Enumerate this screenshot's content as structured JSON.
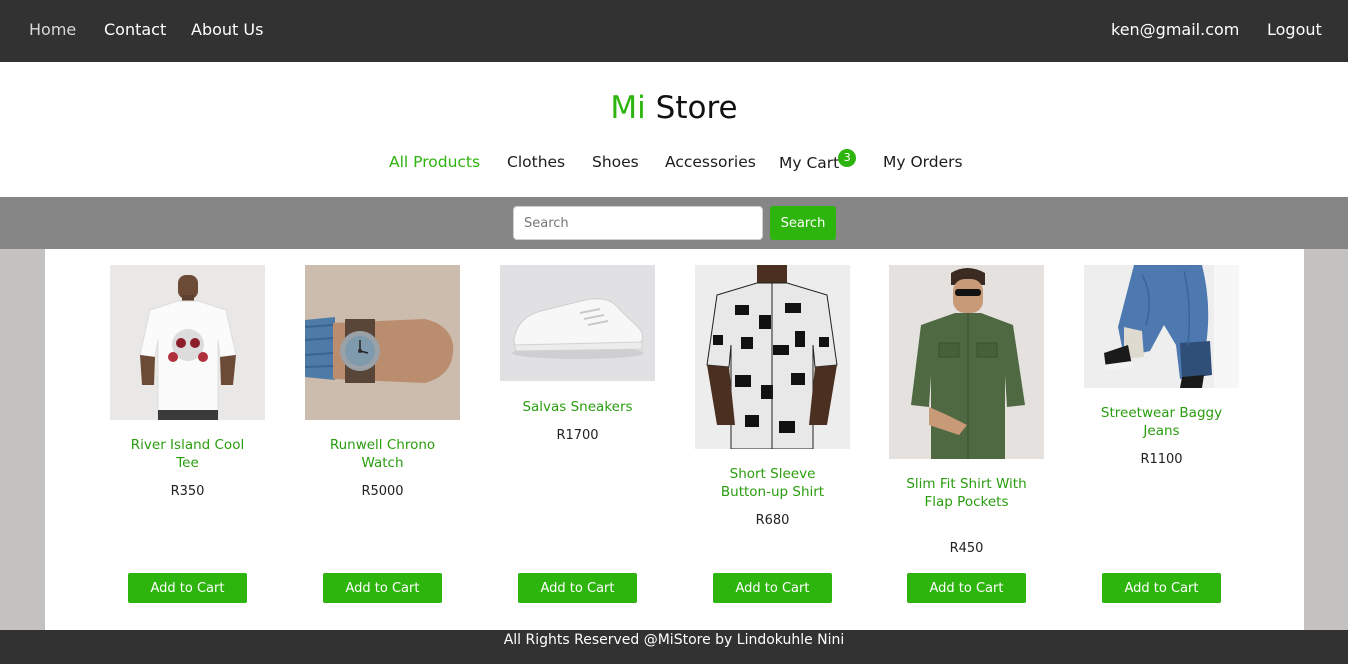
{
  "nav": {
    "home": "Home",
    "contact": "Contact",
    "about": "About Us",
    "user_email": "ken@gmail.com",
    "logout": "Logout"
  },
  "brand": {
    "part1": "Mi",
    "part2": "Store",
    "accent_color": "#2db40d"
  },
  "categories": {
    "all": "All Products",
    "clothes": "Clothes",
    "shoes": "Shoes",
    "accessories": "Accessories",
    "cart": "My Cart",
    "cart_count": "3",
    "orders": "My Orders"
  },
  "search": {
    "placeholder": "Search",
    "button": "Search"
  },
  "products": [
    {
      "name": "River Island Cool Tee",
      "price": "R350",
      "button": "Add to Cart",
      "image_icon": "white-tshirt-image"
    },
    {
      "name": "Runwell Chrono Watch",
      "price": "R5000",
      "button": "Add to Cart",
      "image_icon": "wrist-watch-image"
    },
    {
      "name": "Salvas Sneakers",
      "price": "R1700",
      "button": "Add to Cart",
      "image_icon": "white-sneaker-image"
    },
    {
      "name": "Short Sleeve Button-up Shirt",
      "price": "R680",
      "button": "Add to Cart",
      "image_icon": "patterned-shirt-image"
    },
    {
      "name": "Slim Fit Shirt With Flap Pockets",
      "price": "R450",
      "button": "Add to Cart",
      "image_icon": "green-shirt-image"
    },
    {
      "name": "Streetwear Baggy Jeans",
      "price": "R1100",
      "button": "Add to Cart",
      "image_icon": "baggy-jeans-image"
    }
  ],
  "footer": {
    "text": "All Rights Reserved @MiStore by Lindokuhle Nini"
  }
}
